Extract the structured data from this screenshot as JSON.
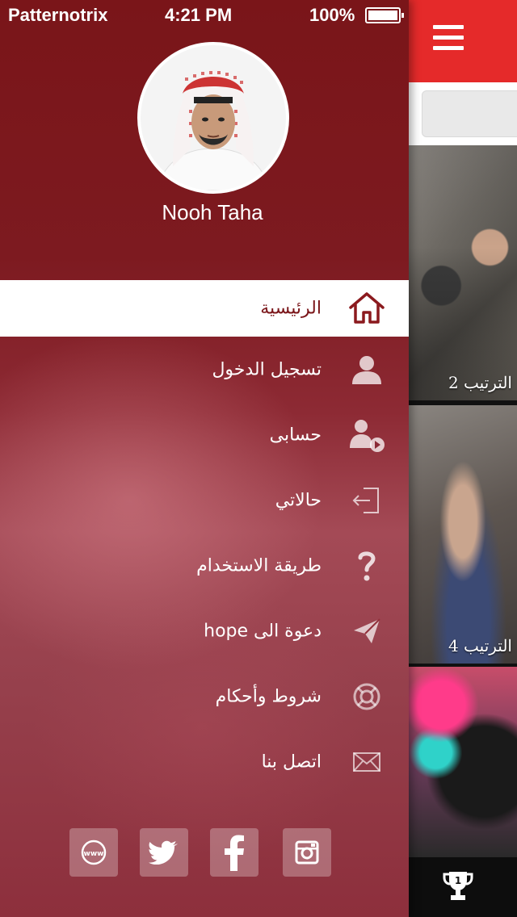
{
  "status_bar": {
    "carrier": "Patternotrix",
    "time": "4:21 PM",
    "battery": "100%"
  },
  "profile": {
    "name": "Nooh Taha"
  },
  "menu": {
    "items": [
      {
        "label": "الرئيسية",
        "icon": "home-icon",
        "active": true
      },
      {
        "label": "تسجيل الدخول",
        "icon": "user-icon",
        "active": false
      },
      {
        "label": "حسابى",
        "icon": "account-icon",
        "active": false
      },
      {
        "label": "حالاتي",
        "icon": "door-exit-icon",
        "active": false
      },
      {
        "label": "طريقة الاستخدام",
        "icon": "question-icon",
        "active": false
      },
      {
        "label": "دعوة الى hope",
        "icon": "paper-plane-icon",
        "active": false
      },
      {
        "label": "شروط وأحكام",
        "icon": "lifebuoy-icon",
        "active": false
      },
      {
        "label": "اتصل بنا",
        "icon": "envelope-icon",
        "active": false
      }
    ]
  },
  "socials": [
    "www-icon",
    "twitter-icon",
    "facebook-icon",
    "instagram-icon"
  ],
  "content": {
    "cards": [
      {
        "rank": "الترتيب 2"
      },
      {
        "rank": "الترتيب 4"
      },
      {
        "rank": ""
      }
    ]
  },
  "colors": {
    "accent_red": "#e52a2a",
    "drawer_dark": "#7a1519",
    "drawer_light": "#a44a56"
  }
}
